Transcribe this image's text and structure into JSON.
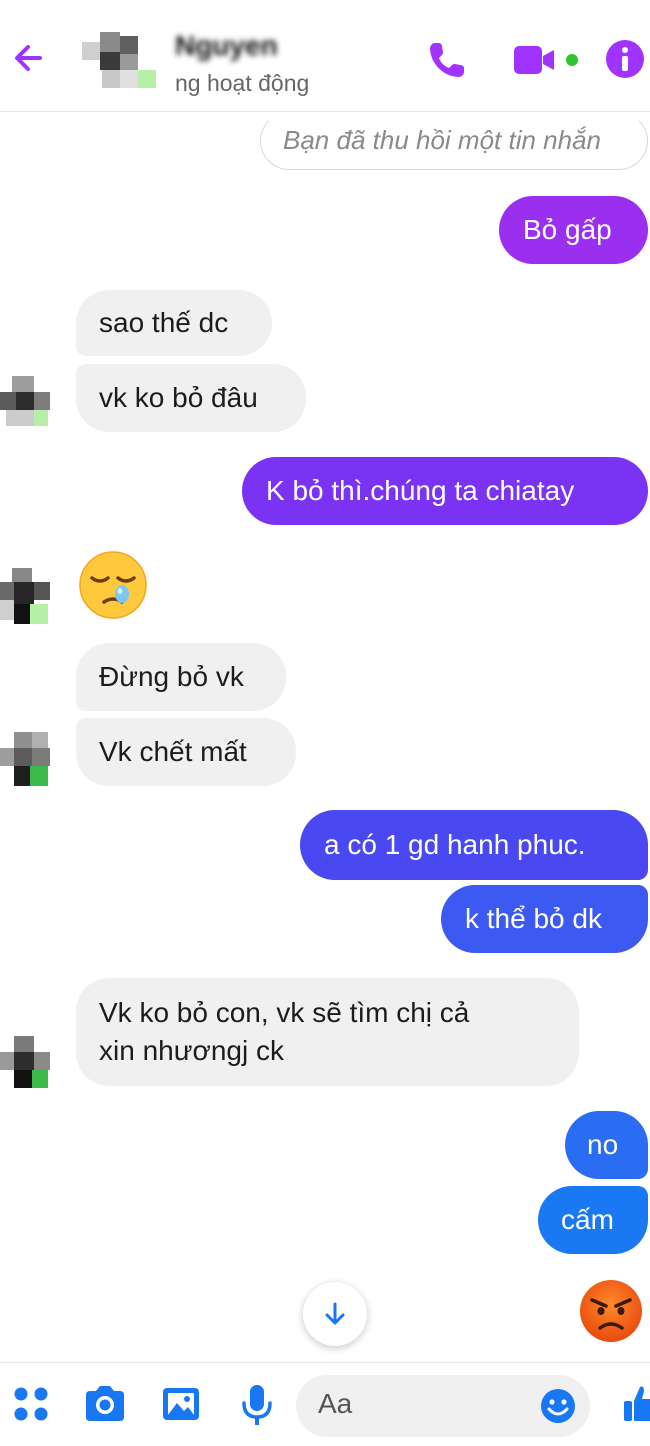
{
  "header": {
    "contact_name": "Nguyen",
    "status": "ng hoạt động"
  },
  "messages": {
    "recall_notice": "Bạn đã thu hồi một tin nhắn",
    "m1": "Bỏ gấp",
    "m2": "sao thế dc",
    "m3": "vk ko bỏ đâu",
    "m4": "K bỏ thì.chúng ta chiatay",
    "m5": "Đừng bỏ vk",
    "m6": "Vk chết mất",
    "m7": "a có 1 gd hanh phuc.",
    "m8": "k thể bỏ dk",
    "m9_line1": "Vk ko bỏ con,  vk sẽ tìm chị cả",
    "m9_line2": "xin nhươngj ck",
    "m10": "no",
    "m11": "cấm"
  },
  "composer": {
    "placeholder": "Aa"
  },
  "colors": {
    "accent": "#a033ff",
    "bubble_purple": "#9b2ff0",
    "bubble_violet": "#6f3cf6",
    "bubble_blue": "#3a55f0",
    "bubble_lightblue": "#1678f2",
    "incoming": "#f0f0f0",
    "composer_icons": "#1877f2"
  }
}
